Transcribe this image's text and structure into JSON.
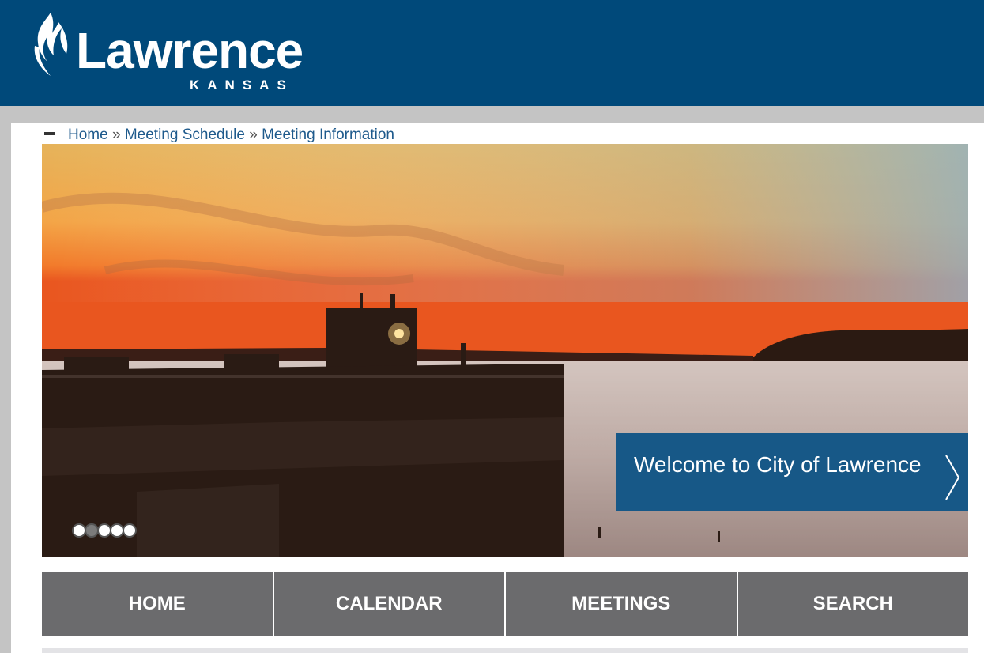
{
  "header": {
    "logo_name": "Lawrence",
    "logo_state": "KANSAS",
    "logo_icon": "flame-icon",
    "bg_color": "#00497a"
  },
  "breadcrumb": {
    "toggle_icon": "minus-icon",
    "items": [
      "Home",
      "Meeting Schedule",
      "Meeting Information"
    ],
    "separator": "»"
  },
  "hero": {
    "caption": "Welcome to City of Lawrence",
    "next_icon": "chevron-right-icon",
    "slide_count": 5,
    "active_slide": 2,
    "caption_color": "#175887"
  },
  "nav": {
    "items": [
      "HOME",
      "CALENDAR",
      "MEETINGS",
      "SEARCH"
    ],
    "bg_color": "#6b6b6d"
  }
}
